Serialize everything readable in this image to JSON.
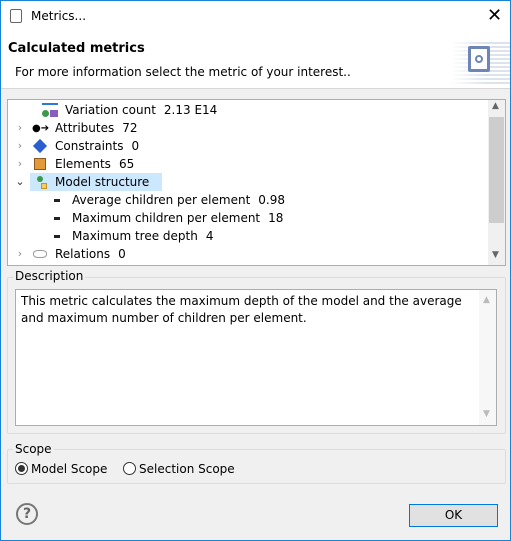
{
  "window": {
    "title": "Metrics...",
    "close_icon": "close-icon"
  },
  "header": {
    "title": "Calculated metrics",
    "subtitle": "For more information select the metric of your interest..",
    "banner_icon": "metrics-refresh-icon"
  },
  "tree": {
    "items": [
      {
        "label": "Variation count",
        "value": "2.13 E14",
        "icon": "variation-icon",
        "expander": "none"
      },
      {
        "label": "Attributes",
        "value": "72",
        "icon": "attribute-icon",
        "expander": "collapsed"
      },
      {
        "label": "Constraints",
        "value": "0",
        "icon": "constraint-icon",
        "expander": "collapsed"
      },
      {
        "label": "Elements",
        "value": "65",
        "icon": "elements-icon",
        "expander": "collapsed"
      },
      {
        "label": "Model structure",
        "value": "",
        "icon": "model-structure-icon",
        "expander": "expanded",
        "selected": true
      },
      {
        "label": "Average children per element",
        "value": "0.98",
        "icon": "bullet-icon",
        "child": true
      },
      {
        "label": "Maximum children per element",
        "value": "18",
        "icon": "bullet-icon",
        "child": true
      },
      {
        "label": "Maximum tree depth",
        "value": "4",
        "icon": "bullet-icon",
        "child": true
      },
      {
        "label": "Relations",
        "value": "0",
        "icon": "relations-icon",
        "expander": "collapsed"
      }
    ]
  },
  "description": {
    "label": "Description",
    "text": "This metric calculates the maximum depth of the model and the average and maximum number of children per element."
  },
  "scope": {
    "label": "Scope",
    "options": [
      {
        "label": "Model Scope",
        "selected": true
      },
      {
        "label": "Selection Scope",
        "selected": false
      }
    ]
  },
  "footer": {
    "ok_label": "OK",
    "help_icon": "help-icon"
  },
  "colors": {
    "selection": "#cce8ff",
    "accent": "#0078d7"
  }
}
